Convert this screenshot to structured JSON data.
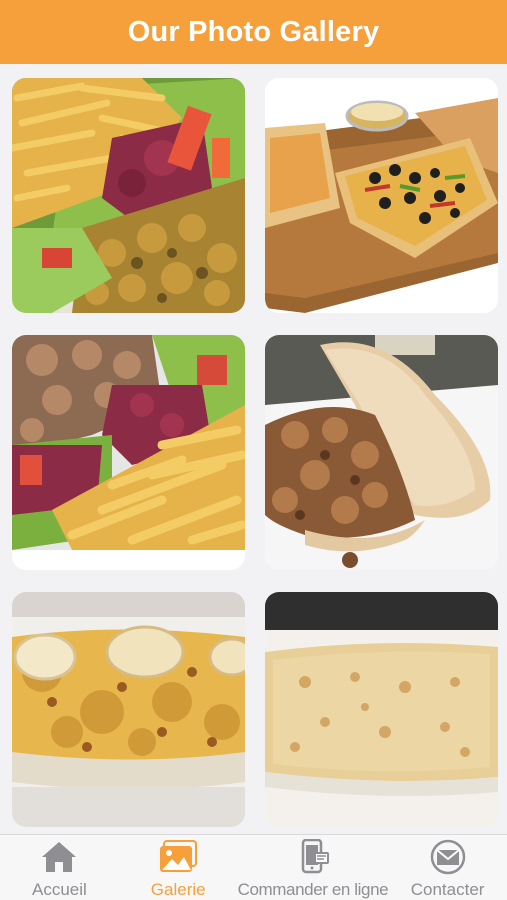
{
  "header": {
    "title": "Our Photo Gallery"
  },
  "colors": {
    "accent": "#f5a03a",
    "inactive": "#8e8e93",
    "background": "#f2f2f4"
  },
  "gallery": {
    "photos": [
      {
        "icon": "fries-salad-chicken-photo"
      },
      {
        "icon": "pizza-board-photo"
      },
      {
        "icon": "kebab-fries-salad-photo"
      },
      {
        "icon": "kebab-pita-sandwich-photo"
      },
      {
        "icon": "cheese-gratin-photo"
      },
      {
        "icon": "grilled-wrap-photo"
      }
    ]
  },
  "tabbar": {
    "items": [
      {
        "label": "Accueil",
        "icon": "house-icon",
        "active": false
      },
      {
        "label": "Galerie",
        "icon": "photos-icon",
        "active": true
      },
      {
        "label": "Commander en ligne",
        "icon": "phone-order-icon",
        "active": false
      },
      {
        "label": "Contacter",
        "icon": "envelope-icon",
        "active": false
      }
    ]
  }
}
